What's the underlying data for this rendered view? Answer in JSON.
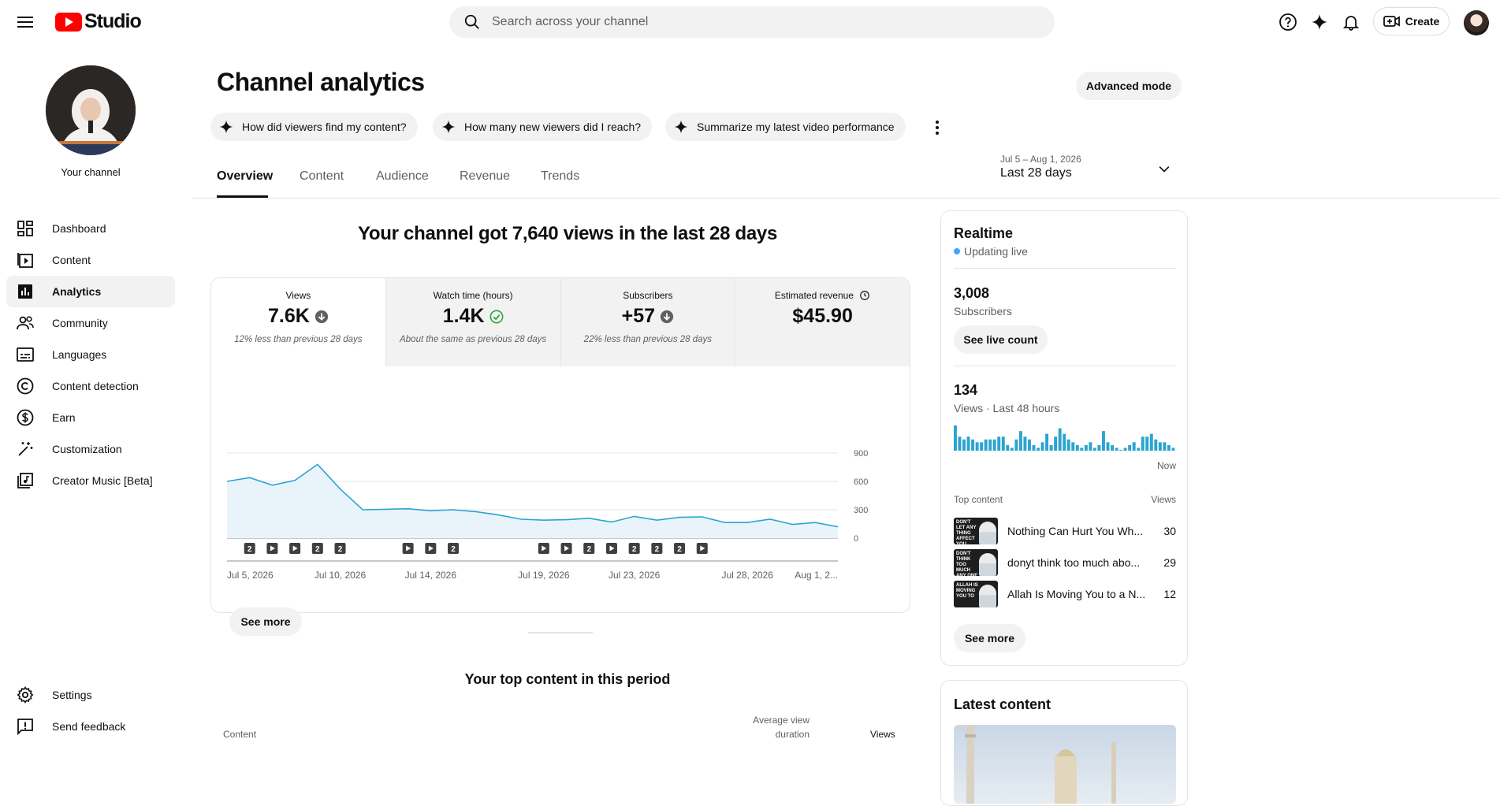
{
  "topbar": {
    "logo_text": "Studio",
    "search_placeholder": "Search across your channel",
    "create_label": "Create"
  },
  "sidebar": {
    "channel_label": "Your channel",
    "items": [
      {
        "label": "Dashboard",
        "icon": "dashboard-icon"
      },
      {
        "label": "Content",
        "icon": "content-icon"
      },
      {
        "label": "Analytics",
        "icon": "analytics-icon",
        "active": true
      },
      {
        "label": "Community",
        "icon": "community-icon"
      },
      {
        "label": "Languages",
        "icon": "subtitles-icon"
      },
      {
        "label": "Content detection",
        "icon": "copyright-icon"
      },
      {
        "label": "Earn",
        "icon": "dollar-icon"
      },
      {
        "label": "Customization",
        "icon": "magic-wand-icon"
      },
      {
        "label": "Creator Music [Beta]",
        "icon": "music-icon"
      }
    ],
    "bottom": [
      {
        "label": "Settings",
        "icon": "gear-icon"
      },
      {
        "label": "Send feedback",
        "icon": "feedback-icon"
      }
    ]
  },
  "main": {
    "title": "Channel analytics",
    "advanced_mode": "Advanced mode",
    "chips": [
      "How did viewers find my content?",
      "How many new viewers did I reach?",
      "Summarize my latest video performance"
    ],
    "tabs": [
      "Overview",
      "Content",
      "Audience",
      "Revenue",
      "Trends"
    ],
    "active_tab": "Overview",
    "date_range": {
      "dates": "Jul 5 – Aug 1, 2026",
      "label": "Last 28 days"
    }
  },
  "overview": {
    "headline": "Your channel got 7,640 views in the last 28 days",
    "metrics": [
      {
        "label": "Views",
        "value": "7.6K",
        "comparison": "12% less than previous 28 days",
        "trend": "down"
      },
      {
        "label": "Watch time (hours)",
        "value": "1.4K",
        "comparison": "About the same as previous 28 days",
        "trend": "same"
      },
      {
        "label": "Subscribers",
        "value": "+57",
        "comparison": "22% less than previous 28 days",
        "trend": "down"
      },
      {
        "label": "Estimated revenue",
        "value": "$45.90",
        "comparison": "",
        "trend": "none"
      }
    ],
    "see_more": "See more",
    "top_content_title": "Your top content in this period",
    "table_headers": {
      "content": "Content",
      "avg_duration_1": "Average view",
      "avg_duration_2": "duration",
      "views": "Views"
    }
  },
  "chart_data": {
    "type": "area",
    "series": [
      {
        "values": [
          600,
          640,
          560,
          610,
          780,
          520,
          300,
          305,
          310,
          290,
          300,
          280,
          245,
          200,
          190,
          195,
          210,
          170,
          230,
          190,
          220,
          225,
          165,
          165,
          200,
          145,
          165,
          120
        ]
      }
    ],
    "y_ticks": [
      "900",
      "600",
      "300",
      "0"
    ],
    "ylim": [
      0,
      900
    ],
    "x_tick_labels": [
      "Jul 5, 2026",
      "Jul 10, 2026",
      "Jul 14, 2026",
      "Jul 19, 2026",
      "Jul 23, 2026",
      "Jul 28, 2026",
      "Aug 1, 2..."
    ],
    "x_tick_index": [
      0,
      5,
      9,
      14,
      18,
      23,
      27
    ],
    "markers": [
      {
        "i": 1,
        "kind": "number",
        "text": "2"
      },
      {
        "i": 2,
        "kind": "video"
      },
      {
        "i": 3,
        "kind": "video"
      },
      {
        "i": 4,
        "kind": "number",
        "text": "2"
      },
      {
        "i": 5,
        "kind": "number",
        "text": "2"
      },
      {
        "i": 8,
        "kind": "video"
      },
      {
        "i": 9,
        "kind": "video"
      },
      {
        "i": 10,
        "kind": "number",
        "text": "2"
      },
      {
        "i": 14,
        "kind": "video"
      },
      {
        "i": 15,
        "kind": "video"
      },
      {
        "i": 16,
        "kind": "number",
        "text": "2"
      },
      {
        "i": 17,
        "kind": "video"
      },
      {
        "i": 18,
        "kind": "number",
        "text": "2"
      },
      {
        "i": 19,
        "kind": "number",
        "text": "2"
      },
      {
        "i": 20,
        "kind": "number",
        "text": "2"
      },
      {
        "i": 21,
        "kind": "video"
      }
    ],
    "grid": true,
    "color": "#2ba4d0"
  },
  "realtime": {
    "title": "Realtime",
    "status": "Updating live",
    "subscribers_value": "3,008",
    "subscribers_label": "Subscribers",
    "see_live_count": "See live count",
    "views_value": "134",
    "views_label": "Views · Last 48 hours",
    "now_label": "Now",
    "bars": [
      9,
      5,
      4,
      5,
      4,
      3,
      3,
      4,
      4,
      4,
      5,
      5,
      2,
      1,
      4,
      7,
      5,
      4,
      2,
      1,
      3,
      6,
      2,
      5,
      8,
      6,
      4,
      3,
      2,
      1,
      2,
      3,
      1,
      2,
      7,
      3,
      2,
      1,
      0,
      1,
      2,
      3,
      1,
      5,
      5,
      6,
      4,
      3,
      3,
      2,
      1
    ],
    "top_content_label": "Top content",
    "views_col": "Views",
    "top_content": [
      {
        "title": "Nothing Can Hurt You Wh...",
        "views": "30",
        "thumb_text": "DON'T LET ANY THING AFFECT YOU"
      },
      {
        "title": "donyt think too much abo...",
        "views": "29",
        "thumb_text": "DON'T THINK TOO MUCH ANY ONE"
      },
      {
        "title": "Allah Is Moving You to a N...",
        "views": "12",
        "thumb_text": "ALLAH IS MOVING YOU TO"
      }
    ],
    "see_more": "See more"
  },
  "latest_content": {
    "title": "Latest content"
  }
}
